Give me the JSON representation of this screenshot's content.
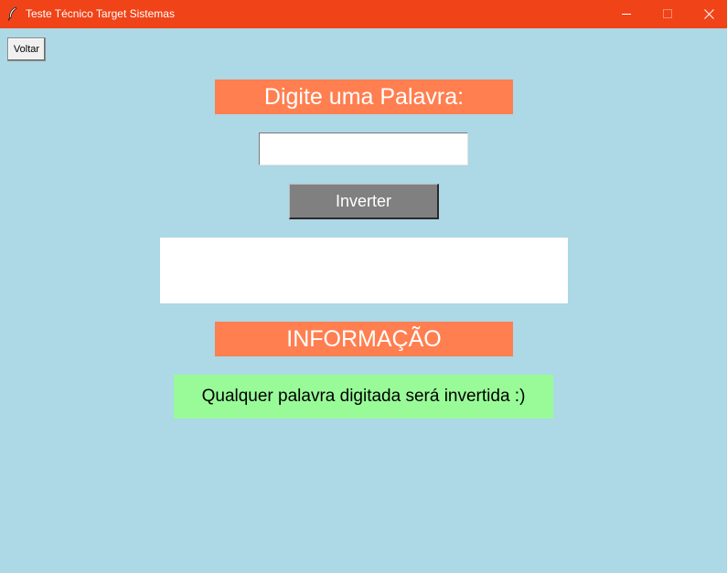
{
  "window": {
    "title": "Teste Técnico Target Sistemas",
    "titlebar_color": "#f04318",
    "background_color": "#add8e6",
    "icons": [
      "feather-icon",
      "minimize-icon",
      "maximize-icon",
      "close-icon"
    ]
  },
  "toolbar": {
    "back_label": "Voltar"
  },
  "main": {
    "heading": "Digite uma Palavra:",
    "input_value": "",
    "invert_label": "Inverter",
    "result_text": "",
    "info_heading": "INFORMAÇÃO",
    "info_text": "Qualquer palavra digitada será invertida :)",
    "heading_color": "#ff7f50",
    "button_color": "#808080",
    "info_color": "#98fb98"
  }
}
